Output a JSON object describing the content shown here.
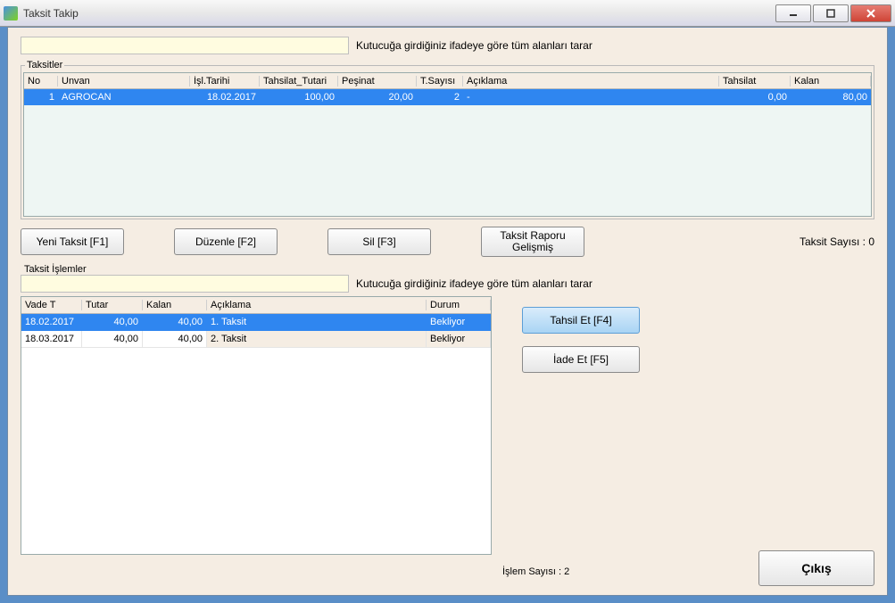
{
  "window": {
    "title": "Taksit Takip"
  },
  "search1": {
    "placeholder": "",
    "hint": "Kutucuğa girdiğiniz ifadeye göre tüm alanları tarar"
  },
  "group1": {
    "legend": "Taksitler",
    "headers": {
      "no": "No",
      "unvan": "Unvan",
      "tarih": "İşl.Tarihi",
      "tutar": "Tahsilat_Tutari",
      "pesinat": "Peşinat",
      "tsayi": "T.Sayısı",
      "aciklama": "Açıklama",
      "tahsilat": "Tahsilat",
      "kalan": "Kalan"
    },
    "rows": [
      {
        "no": "1",
        "unvan": "AGROCAN",
        "tarih": "18.02.2017",
        "tutar": "100,00",
        "pesinat": "20,00",
        "tsayi": "2",
        "aciklama": "-",
        "tahsilat": "0,00",
        "kalan": "80,00"
      }
    ],
    "count_label": "Taksit Sayısı : 0"
  },
  "buttons": {
    "yeni": "Yeni Taksit [F1]",
    "duzenle": "Düzenle [F2]",
    "sil": "Sil [F3]",
    "rapor_l1": "Taksit Raporu",
    "rapor_l2": "Gelişmiş",
    "tahsil": "Tahsil Et [F4]",
    "iade": "İade Et [F5]",
    "cikis": "Çıkış"
  },
  "group2": {
    "legend": "Taksit İşlemler",
    "search_hint": "Kutucuğa girdiğiniz ifadeye göre tüm alanları tarar",
    "headers": {
      "vade": "Vade T",
      "tutar": "Tutar",
      "kalan": "Kalan",
      "aciklama": "Açıklama",
      "durum": "Durum"
    },
    "rows": [
      {
        "vade": "18.02.2017",
        "tutar": "40,00",
        "kalan": "40,00",
        "aciklama": "1. Taksit",
        "durum": "Bekliyor",
        "selected": true
      },
      {
        "vade": "18.03.2017",
        "tutar": "40,00",
        "kalan": "40,00",
        "aciklama": "2. Taksit",
        "durum": "Bekliyor",
        "selected": false
      }
    ],
    "count_label": "İşlem Sayısı : 2"
  }
}
